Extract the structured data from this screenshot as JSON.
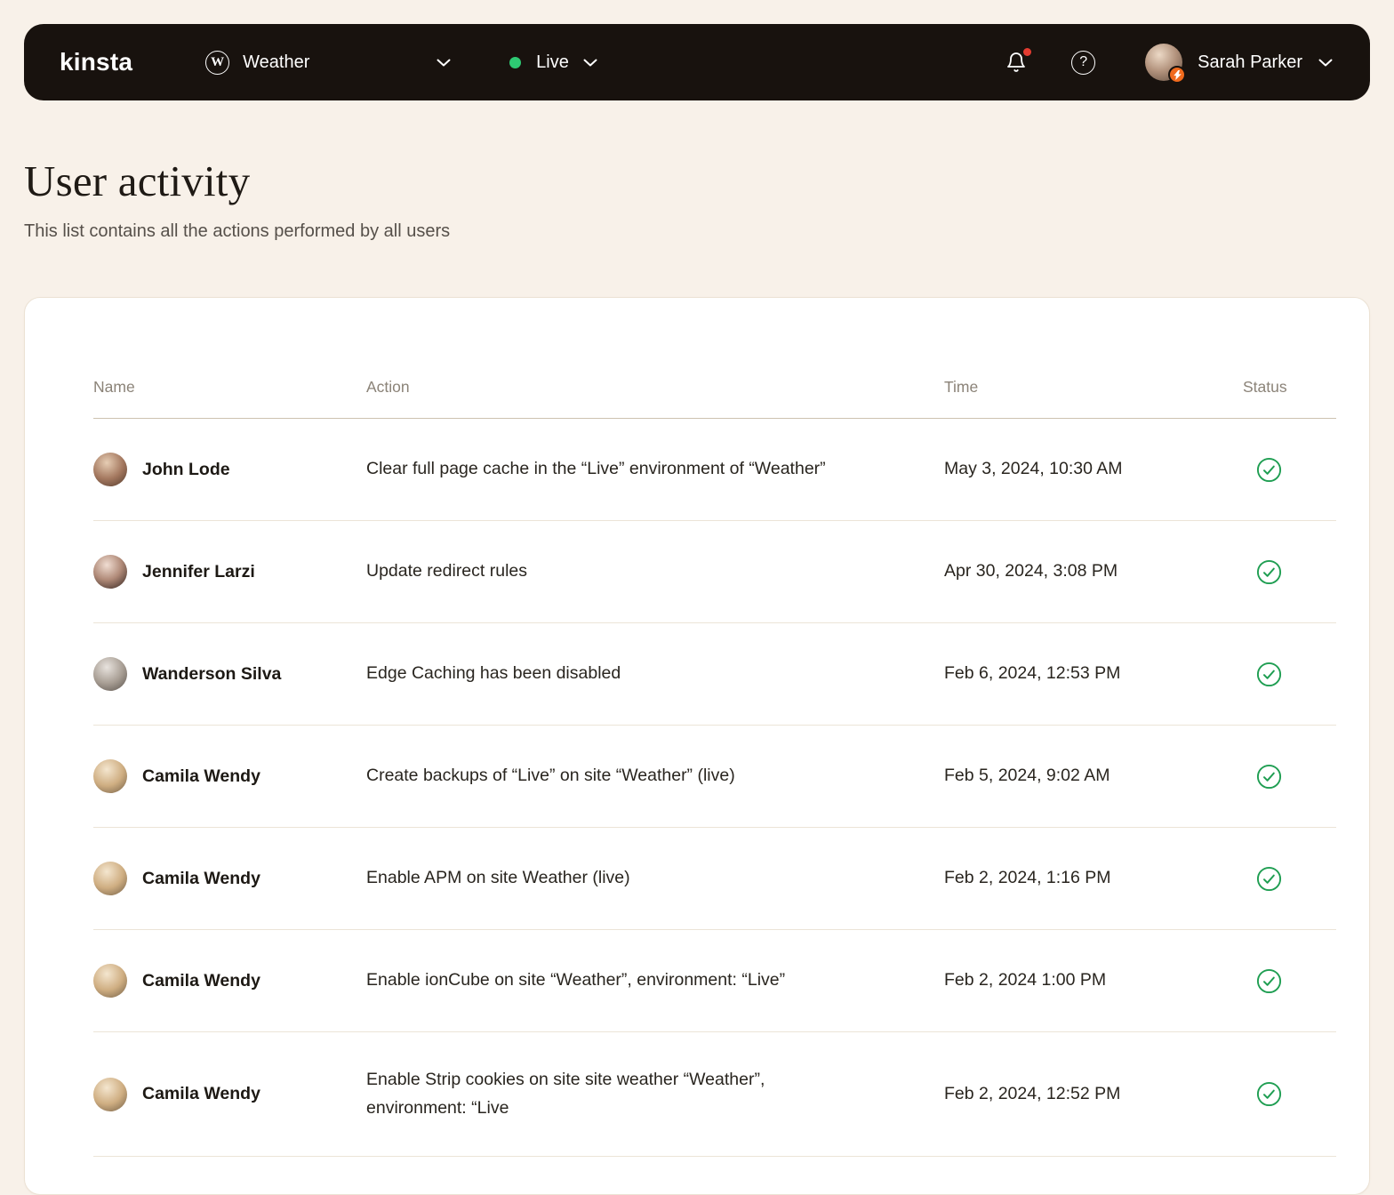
{
  "navbar": {
    "logo": "kinsta",
    "wordpress_glyph": "W",
    "site_selector": {
      "label": "Weather"
    },
    "env_selector": {
      "label": "Live"
    },
    "help_glyph": "?",
    "user": {
      "name": "Sarah Parker"
    }
  },
  "page": {
    "title": "User activity",
    "subtitle": "This list contains all the actions performed by all users"
  },
  "activity_table": {
    "headers": {
      "name": "Name",
      "action": "Action",
      "time": "Time",
      "status": "Status"
    },
    "rows": [
      {
        "name": "John Lode",
        "action": "Clear full page cache in the “Live” environment of “Weather”",
        "time": "May 3, 2024, 10:30 AM",
        "status": "success"
      },
      {
        "name": "Jennifer Larzi",
        "action": "Update redirect rules",
        "time": "Apr 30, 2024, 3:08 PM",
        "status": "success"
      },
      {
        "name": "Wanderson Silva",
        "action": "Edge Caching has been disabled",
        "time": "Feb 6, 2024, 12:53 PM",
        "status": "success"
      },
      {
        "name": "Camila Wendy",
        "action": "Create backups of “Live” on site “Weather” (live)",
        "time": "Feb 5, 2024, 9:02 AM",
        "status": "success"
      },
      {
        "name": "Camila Wendy",
        "action": "Enable APM on site Weather (live)",
        "time": "Feb 2, 2024, 1:16 PM",
        "status": "success"
      },
      {
        "name": "Camila Wendy",
        "action": "Enable ionCube on site “Weather”, environment: “Live”",
        "time": "Feb 2, 2024 1:00 PM",
        "status": "success"
      },
      {
        "name": "Camila Wendy",
        "action": "Enable Strip cookies on site site weather “Weather”, environment: “Live",
        "time": "Feb 2, 2024, 12:52 PM",
        "status": "success"
      }
    ]
  },
  "colors": {
    "background": "#f8f1e9",
    "navbar": "#18120e",
    "live_dot_green": "#2ec973",
    "status_check_green": "#1f9e52",
    "notification_red": "#e33b30",
    "avatar_badge_orange": "#f06a1d"
  }
}
